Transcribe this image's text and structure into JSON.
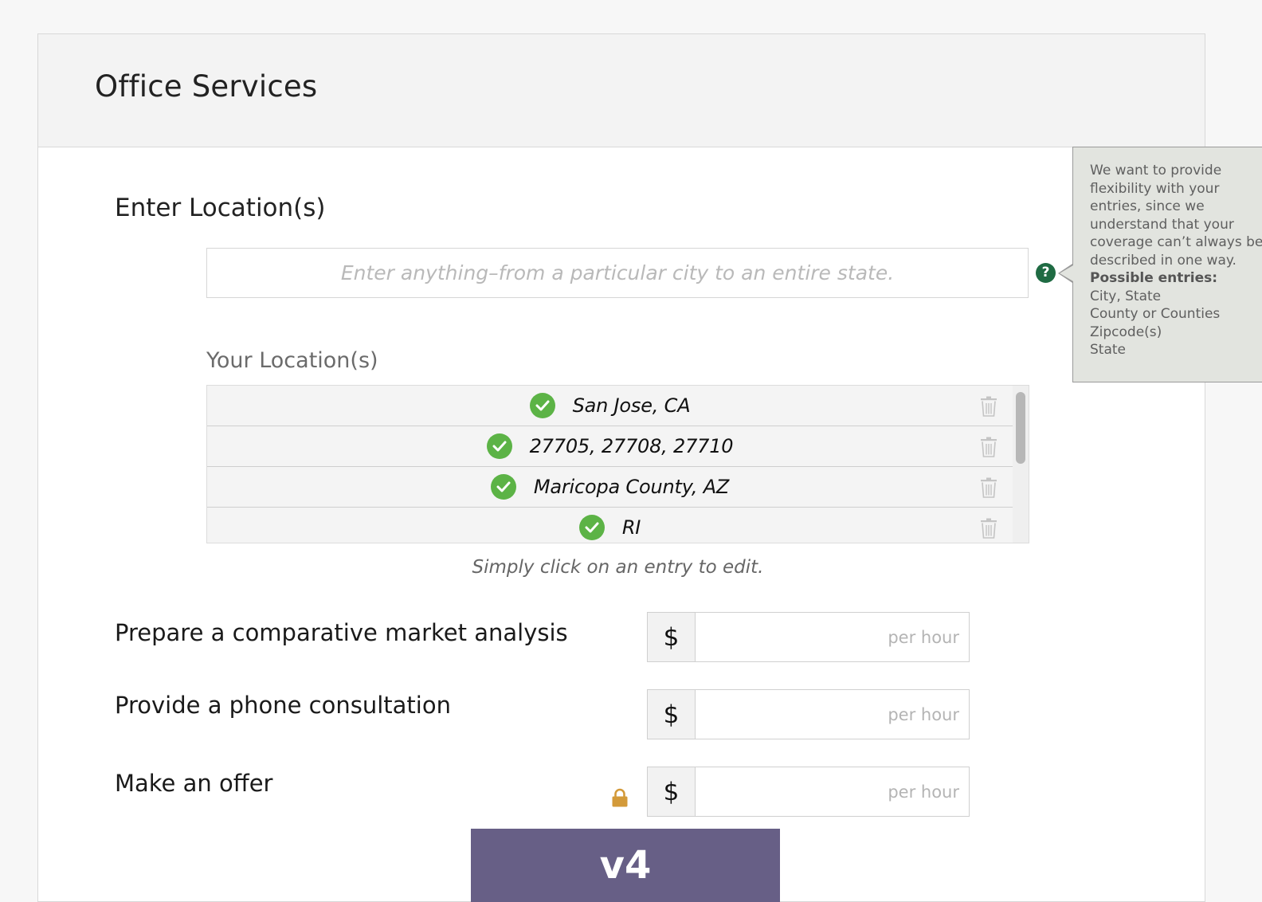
{
  "header": {
    "title": "Office Services"
  },
  "location": {
    "section_title": "Enter Location(s)",
    "input_value": "",
    "input_placeholder": "Enter anything–from a particular city to an entire state.",
    "help_icon": "question-circle-icon",
    "list_label": "Your Location(s)",
    "entries": [
      {
        "text": "San Jose, CA",
        "status_icon": "check-circle-icon",
        "action_icon": "trash-icon"
      },
      {
        "text": "27705, 27708, 27710",
        "status_icon": "check-circle-icon",
        "action_icon": "trash-icon"
      },
      {
        "text": "Maricopa County, AZ",
        "status_icon": "check-circle-icon",
        "action_icon": "trash-icon"
      },
      {
        "text": "RI",
        "status_icon": "check-circle-icon",
        "action_icon": "trash-icon"
      }
    ],
    "hint": "Simply click on an entry to edit."
  },
  "tooltip": {
    "lines": [
      "We want to provide",
      "flexibility with your",
      "entries, since we",
      "understand that your",
      "coverage can’t always be",
      "described in one way."
    ],
    "possible_heading": "Possible entries:",
    "possible_entries": [
      "City, State",
      "County or Counties",
      "Zipcode(s)",
      "State"
    ]
  },
  "services": [
    {
      "label": "Prepare a comparative market analysis",
      "currency": "$",
      "value": "",
      "placeholder": "per hour",
      "locked": false
    },
    {
      "label": "Provide a phone consultation",
      "currency": "$",
      "value": "",
      "placeholder": "per hour",
      "locked": false
    },
    {
      "label": "Make an offer",
      "currency": "$",
      "value": "",
      "placeholder": "per hour",
      "locked": true,
      "lock_icon": "lock-icon"
    }
  ],
  "badge": {
    "text": "v4"
  },
  "colors": {
    "check": "#5cb346",
    "help_icon": "#1f6b43",
    "lock": "#d39a3a",
    "badge_bg": "#675f86",
    "tooltip_bg": "#e2e4df"
  }
}
